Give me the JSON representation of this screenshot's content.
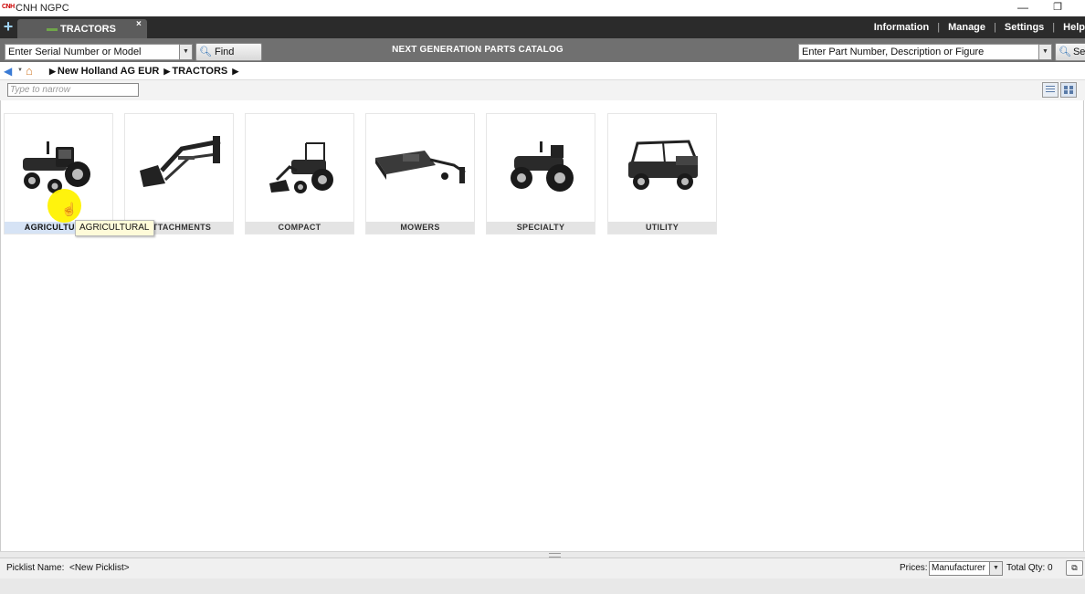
{
  "window": {
    "logo_text": "CNH",
    "title": "CNH NGPC",
    "minimize_glyph": "—",
    "restore_glyph": "❐"
  },
  "tabs": {
    "new_tab_glyph": "+",
    "active": {
      "label": "TRACTORS",
      "close_glyph": "×"
    }
  },
  "top_menu": [
    "Information",
    "Manage",
    "Settings",
    "Help"
  ],
  "search": {
    "serial_placeholder": "Enter Serial Number or Model",
    "find_model_label": "Find Model",
    "center_title": "NEXT GENERATION PARTS CATALOG",
    "part_placeholder": "Enter Part Number, Description or Figure",
    "search_label": "Search",
    "dropdown_glyph": "▼"
  },
  "breadcrumb": {
    "items": [
      "New Holland AG EUR",
      "TRACTORS"
    ],
    "arrow_glyph": "▶"
  },
  "filter": {
    "placeholder": "Type to narrow"
  },
  "categories": [
    {
      "label": "AGRICULTURAL",
      "icon": "agricultural-tractor-image"
    },
    {
      "label": "ATTACHMENTS",
      "icon": "loader-attachment-image"
    },
    {
      "label": "COMPACT",
      "icon": "compact-tractor-image"
    },
    {
      "label": "MOWERS",
      "icon": "mower-image"
    },
    {
      "label": "SPECIALTY",
      "icon": "specialty-tractor-image"
    },
    {
      "label": "UTILITY",
      "icon": "utility-vehicle-image"
    }
  ],
  "tooltip": {
    "text": "AGRICULTURAL"
  },
  "status": {
    "picklist_label": "Picklist Name:",
    "picklist_value": "<New Picklist>",
    "prices_label": "Prices:",
    "prices_value": "Manufacturer",
    "total_qty_label": "Total Qty: 0"
  }
}
